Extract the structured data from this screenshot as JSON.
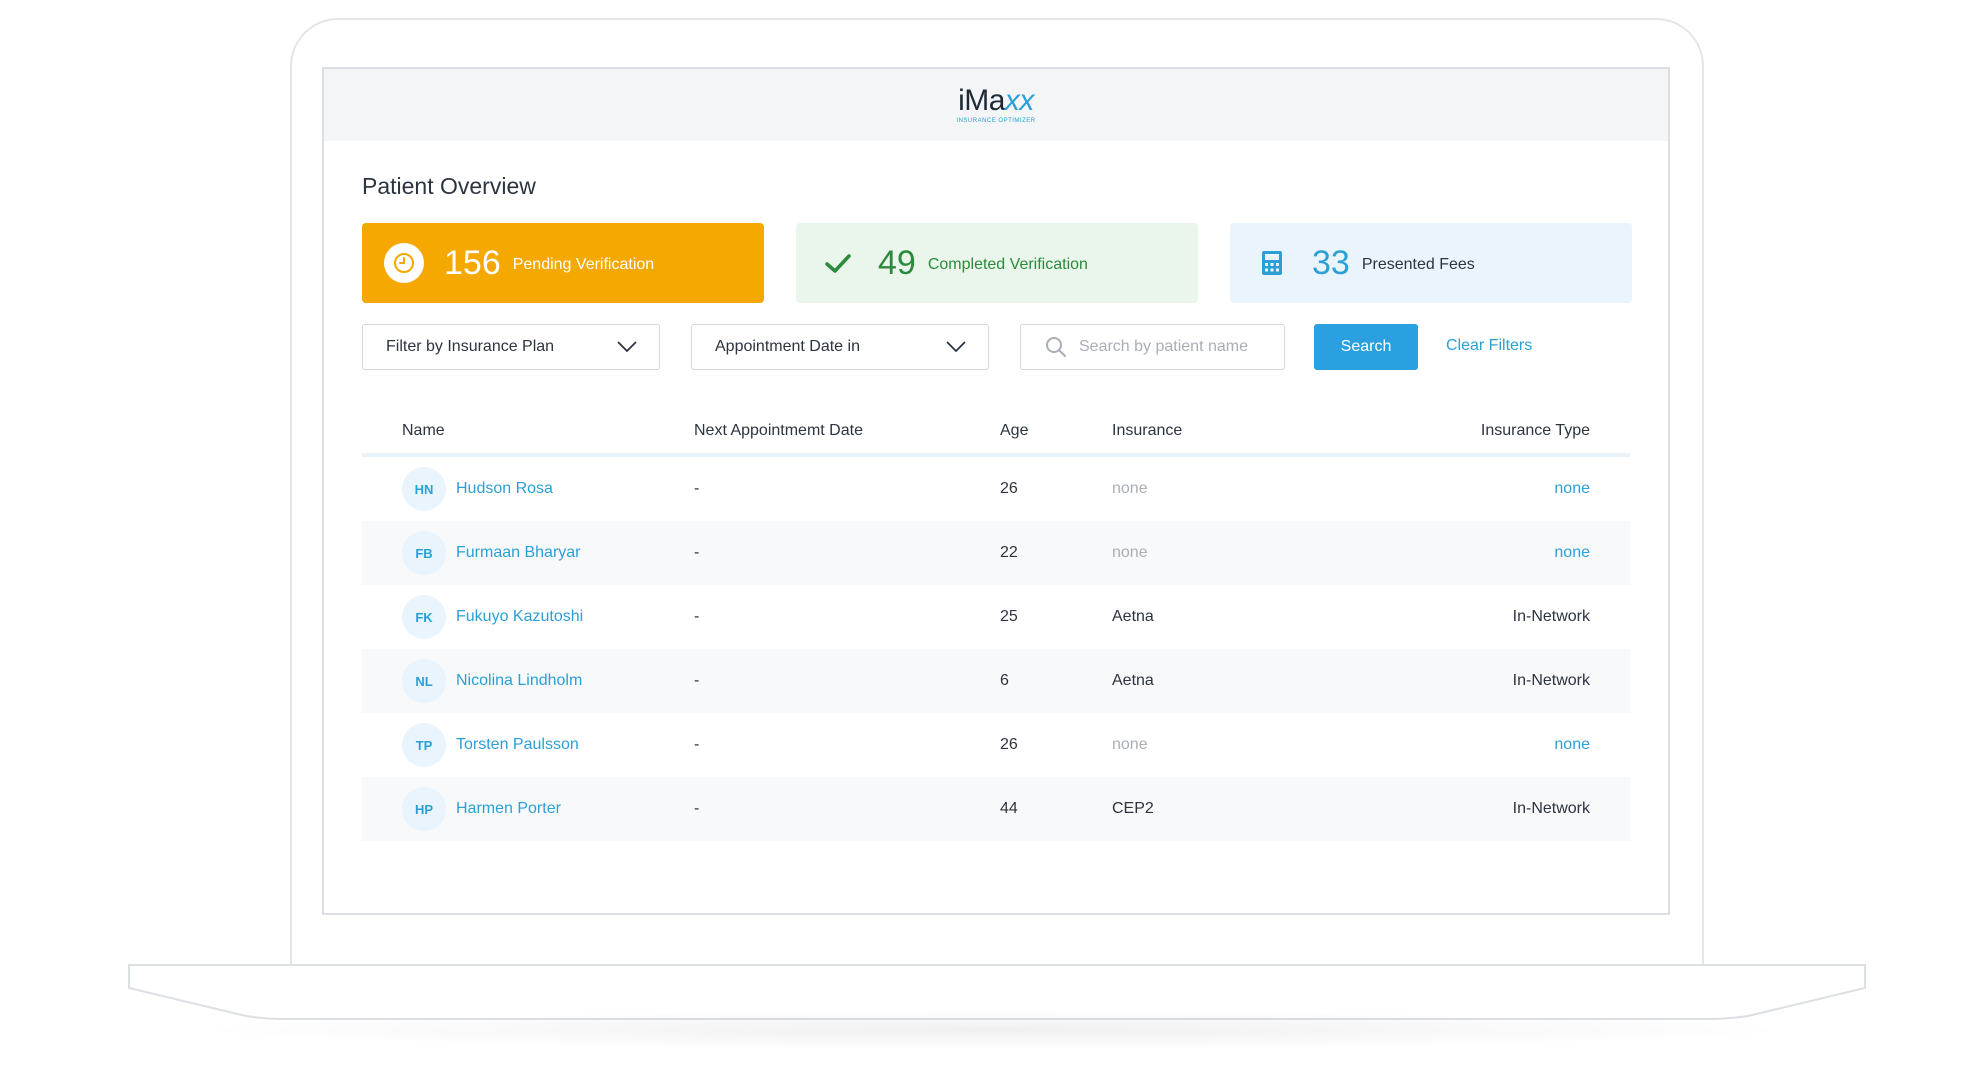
{
  "header": {
    "logo_main": "iMa",
    "logo_accent": "xx",
    "logo_tagline": "INSURANCE OPTIMIZER"
  },
  "page": {
    "title": "Patient Overview"
  },
  "stats": {
    "pending": {
      "value": "156",
      "label": "Pending Verification",
      "icon": "clock-icon",
      "color": "#f5a800"
    },
    "completed": {
      "value": "49",
      "label": "Completed Verification",
      "icon": "checkmark-icon",
      "color": "#2d8a3c"
    },
    "fees": {
      "value": "33",
      "label": "Presented Fees",
      "icon": "calculator-icon",
      "color": "#2aa0d6"
    }
  },
  "filters": {
    "insurance_plan": "Filter by Insurance Plan",
    "appointment_date": "Appointment Date in",
    "search_placeholder": "Search by patient name",
    "search_value": "",
    "search_button": "Search",
    "clear_filters": "Clear Filters"
  },
  "table": {
    "headers": {
      "name": "Name",
      "date": "Next Appointmemt Date",
      "age": "Age",
      "insurance": "Insurance",
      "type": "Insurance Type"
    },
    "rows": [
      {
        "initials": "HN",
        "name": "Hudson Rosa",
        "date": "-",
        "age": "26",
        "insurance": "none",
        "type": "none"
      },
      {
        "initials": "FB",
        "name": "Furmaan Bharyar",
        "date": "-",
        "age": "22",
        "insurance": "none",
        "type": "none"
      },
      {
        "initials": "FK",
        "name": "Fukuyo Kazutoshi",
        "date": "-",
        "age": "25",
        "insurance": "Aetna",
        "type": "In-Network"
      },
      {
        "initials": "NL",
        "name": "Nicolina Lindholm",
        "date": "-",
        "age": "6",
        "insurance": "Aetna",
        "type": "In-Network"
      },
      {
        "initials": "TP",
        "name": "Torsten Paulsson",
        "date": "-",
        "age": "26",
        "insurance": "none",
        "type": "none"
      },
      {
        "initials": "HP",
        "name": "Harmen Porter",
        "date": "-",
        "age": "44",
        "insurance": "CEP2",
        "type": "In-Network"
      }
    ]
  },
  "colors": {
    "accent": "#2aa0d6",
    "pending": "#f5a800",
    "success": "#2d8a3c"
  }
}
